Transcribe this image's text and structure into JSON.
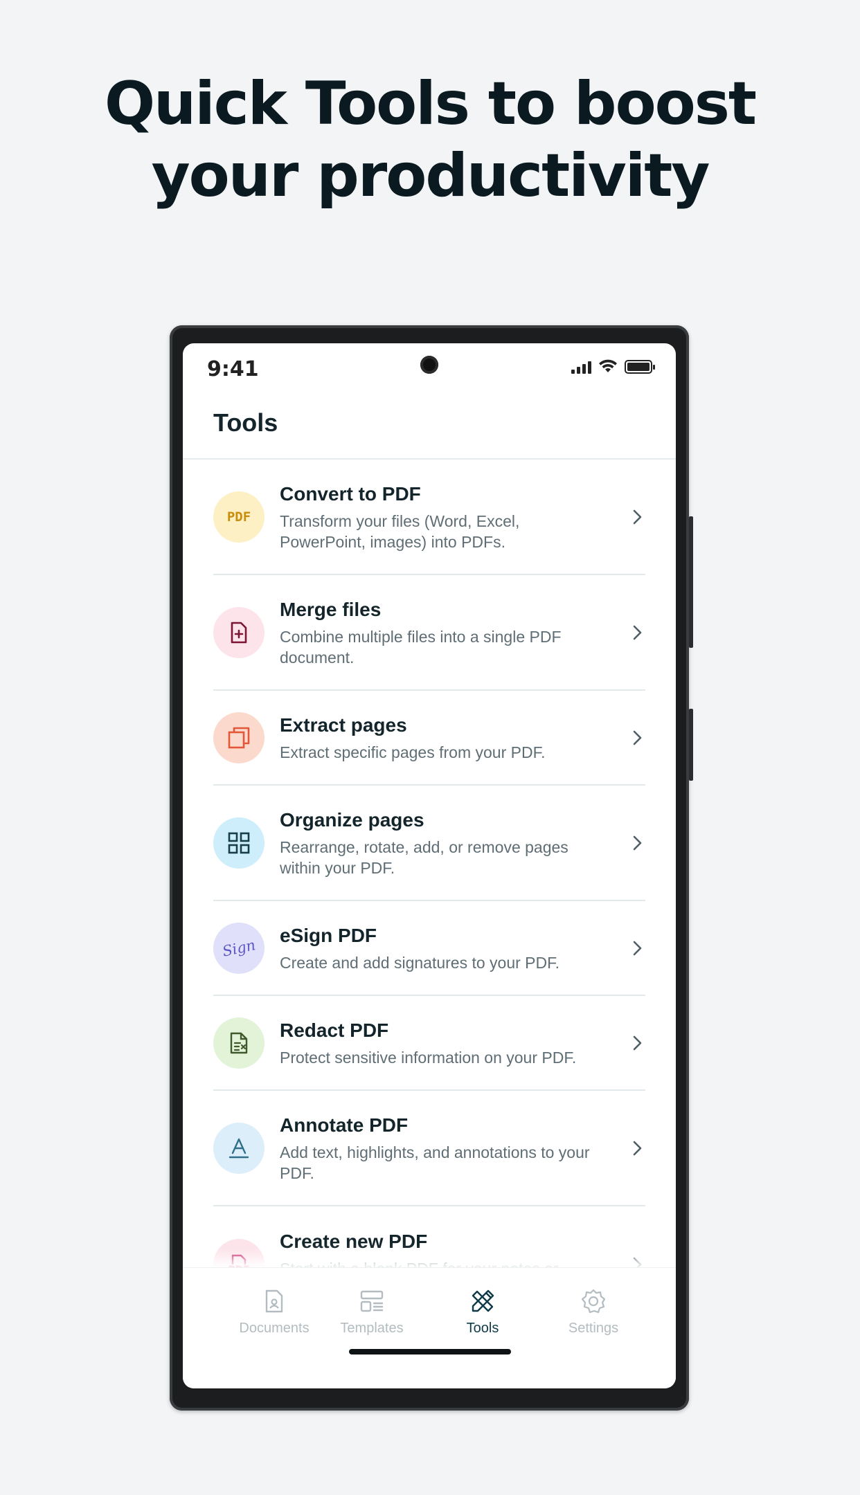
{
  "headline": {
    "line1": "Quick Tools to boost",
    "line2": "your productivity"
  },
  "status_bar": {
    "time": "9:41",
    "icons": [
      "cellular-signal-icon",
      "wifi-icon",
      "battery-icon"
    ]
  },
  "page": {
    "title": "Tools"
  },
  "tools": [
    {
      "title": "Convert to PDF",
      "description": "Transform your files (Word, Excel, PowerPoint, images) into PDFs.",
      "icon": "pdf-badge-icon",
      "icon_text": "PDF",
      "icon_bg": "#fdf0c4",
      "icon_color": "#c98d0e"
    },
    {
      "title": "Merge files",
      "description": "Combine multiple files into a single PDF document.",
      "icon": "file-plus-icon",
      "icon_bg": "#fde4ea",
      "icon_color": "#7a1535"
    },
    {
      "title": "Extract pages",
      "description": "Extract specific pages from your PDF.",
      "icon": "extract-pages-icon",
      "icon_bg": "#fcd9cd",
      "icon_color": "#e2563a"
    },
    {
      "title": "Organize pages",
      "description": "Rearrange, rotate, add, or remove pages within your PDF.",
      "icon": "grid-icon",
      "icon_bg": "#cdeefa",
      "icon_color": "#173e4b"
    },
    {
      "title": "eSign PDF",
      "description": "Create and add signatures to your PDF.",
      "icon": "signature-icon",
      "icon_text": "Sign",
      "icon_bg": "#e1e0fb",
      "icon_color": "#5b57c7"
    },
    {
      "title": "Redact PDF",
      "description": "Protect sensitive information on your PDF.",
      "icon": "redact-document-icon",
      "icon_bg": "#e2f3d8",
      "icon_color": "#3e5a2c"
    },
    {
      "title": "Annotate PDF",
      "description": "Add text, highlights, and annotations to your PDF.",
      "icon": "text-annotate-icon",
      "icon_bg": "#dbeefa",
      "icon_color": "#2f6f8a"
    },
    {
      "title": "Create new PDF",
      "description": "Start with a blank PDF for your notes or projects.",
      "icon": "new-pdf-icon",
      "icon_text": "PDF",
      "icon_bg": "#fde3ea",
      "icon_color": "#c8246a"
    }
  ],
  "bottom_nav": [
    {
      "label": "Documents",
      "icon": "document-icon",
      "active": false
    },
    {
      "label": "Templates",
      "icon": "templates-icon",
      "active": false
    },
    {
      "label": "Tools",
      "icon": "tools-icon",
      "active": true
    },
    {
      "label": "Settings",
      "icon": "gear-icon",
      "active": false
    }
  ],
  "colors": {
    "background": "#f3f4f6",
    "active_nav": "#0f3a48",
    "inactive_nav": "#b3bcc0",
    "text_primary": "#13242b",
    "text_secondary": "#5f6e75"
  }
}
